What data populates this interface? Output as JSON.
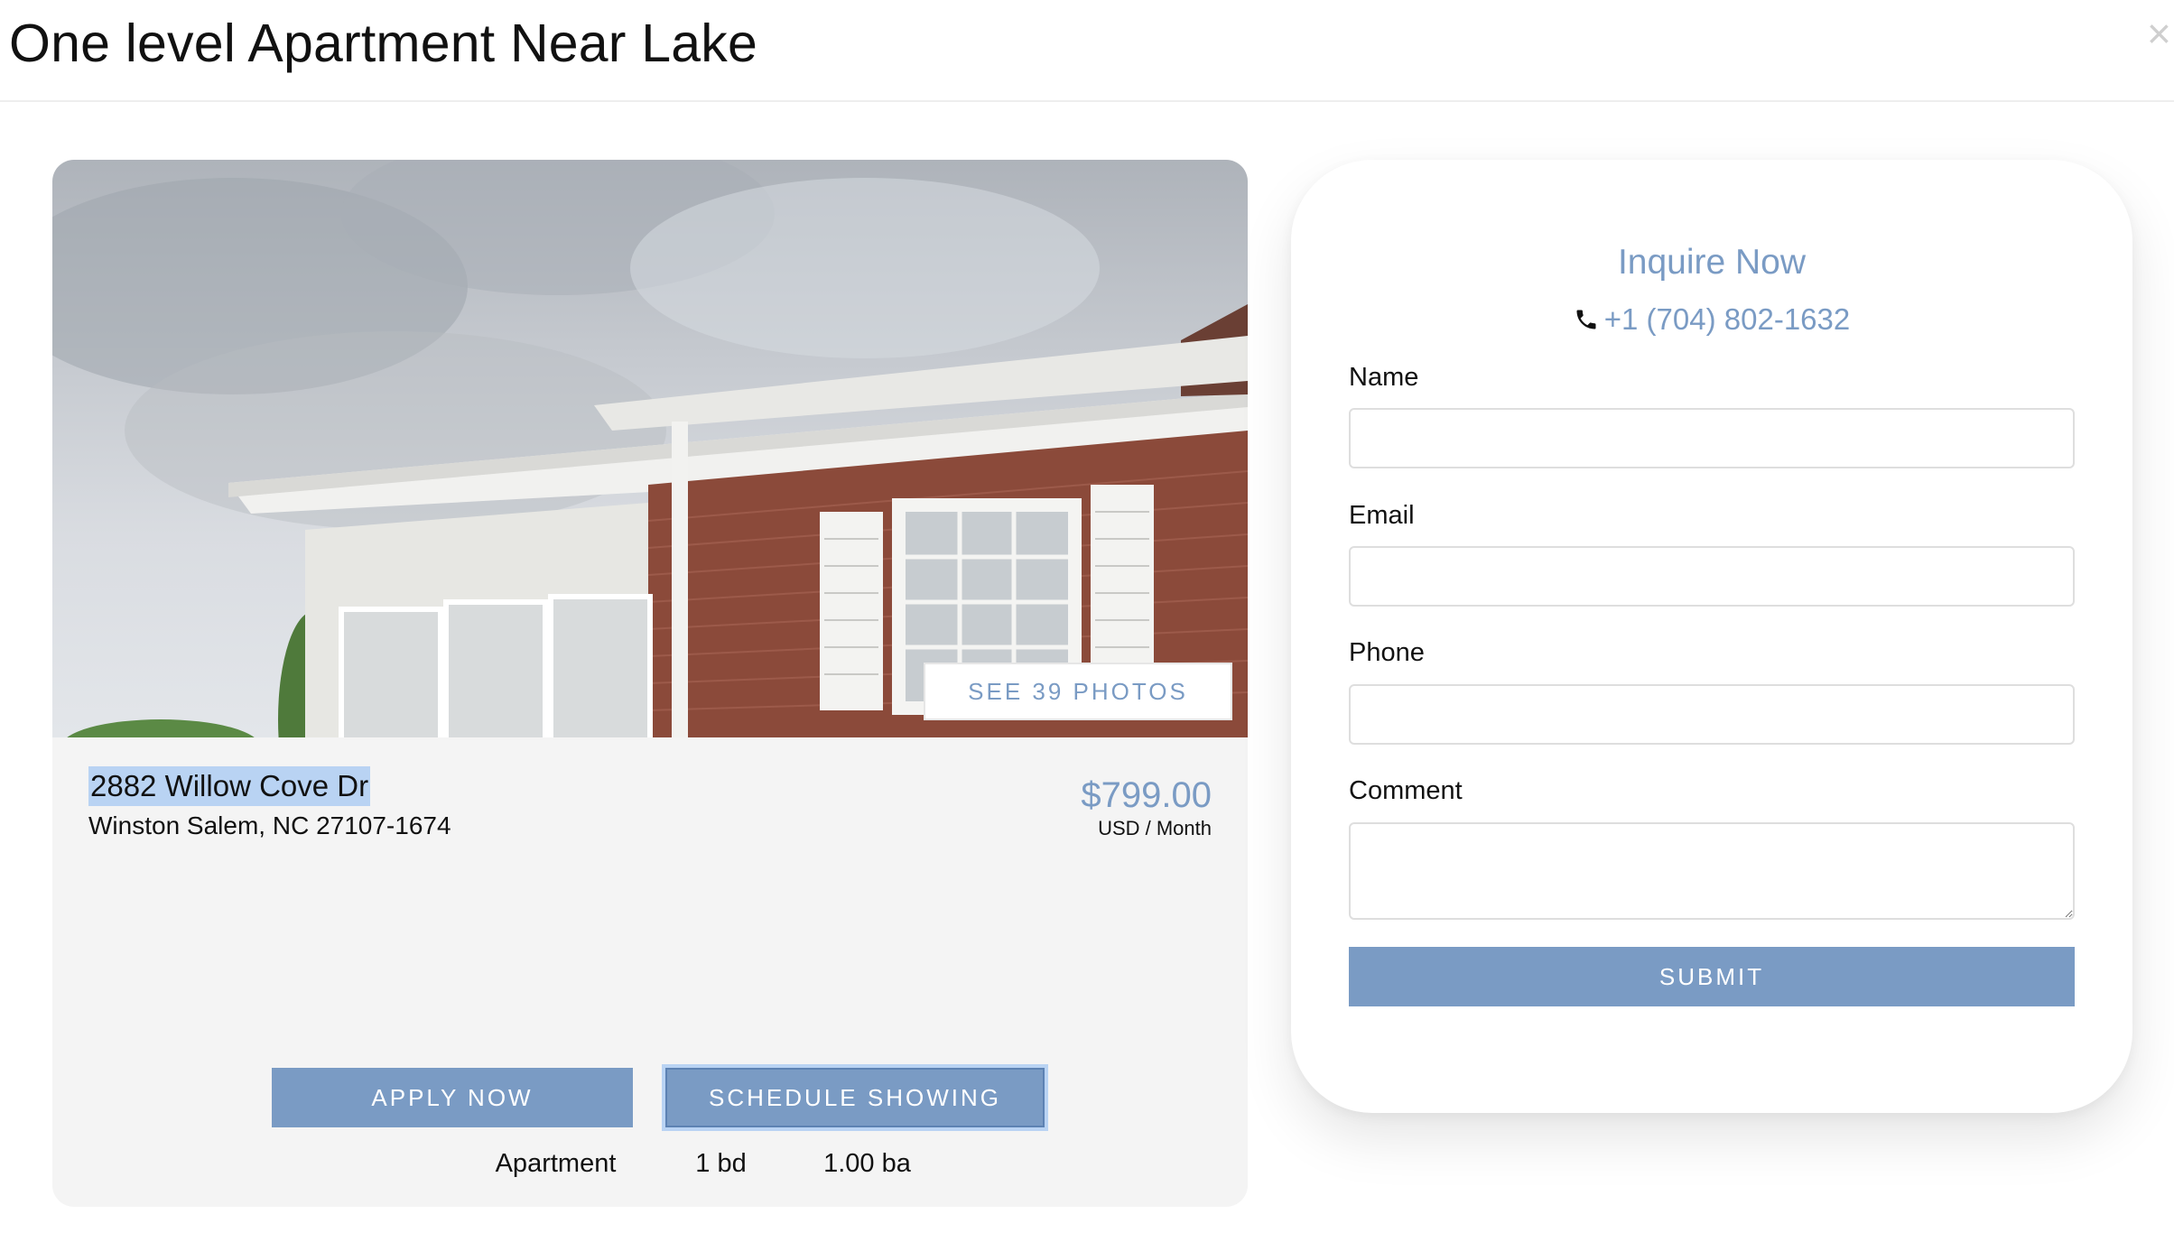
{
  "header": {
    "title": "One level Apartment Near Lake",
    "close_label": "×"
  },
  "listing": {
    "see_photos_label": "SEE 39 PHOTOS",
    "address_line1": "2882 Willow Cove Dr",
    "address_line2": "Winston Salem, NC 27107-1674",
    "price": "$799.00",
    "price_unit": "USD / Month",
    "features": [
      {
        "icon": "house-icon",
        "label": "Apartment"
      },
      {
        "icon": "bed-icon",
        "label": "1 bd"
      },
      {
        "icon": "bathtub-icon",
        "label": "1.00 ba"
      }
    ],
    "apply_label": "APPLY NOW",
    "schedule_label": "SCHEDULE SHOWING"
  },
  "inquire": {
    "title": "Inquire Now",
    "phone_icon": "phone-icon",
    "phone": "+1 (704) 802-1632",
    "fields": [
      {
        "label": "Name",
        "value": ""
      },
      {
        "label": "Email",
        "value": ""
      },
      {
        "label": "Phone",
        "value": ""
      },
      {
        "label": "Comment",
        "value": ""
      }
    ],
    "submit_label": "SUBMIT"
  },
  "colors": {
    "accent": "#7a9bc4",
    "selection": "#b9d3f3",
    "card_background": "#f4f4f4",
    "brick": "#8b4a3a"
  }
}
